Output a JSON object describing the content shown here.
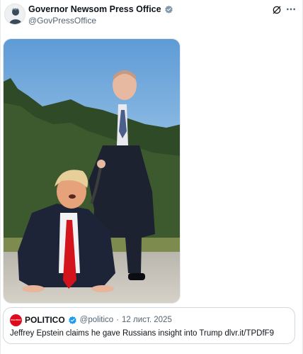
{
  "post": {
    "author_name": "Governor Newsom Press Office",
    "author_handle": "@GovPressOffice",
    "avatar_icon": "state-seal-portrait-icon",
    "verified_icon": "verified-badge-icon",
    "grok_icon": "grok-icon",
    "more_icon": "more-options-icon"
  },
  "media": {
    "description_icon": "photo-two-men-suits-airstrip"
  },
  "quoted_post": {
    "author_name": "POLITICO",
    "logo_text": "POLITICO",
    "author_handle": "@politico",
    "separator": "·",
    "date": "12 лист. 2025",
    "text": "Jeffrey Epstein claims he gave Russians insight into Trump dlvr.it/TPDfF9"
  },
  "colors": {
    "verified_blue": "#1d9bf0",
    "politico_red": "#dc0c1d",
    "text_primary": "#0f1419",
    "text_secondary": "#536471"
  }
}
